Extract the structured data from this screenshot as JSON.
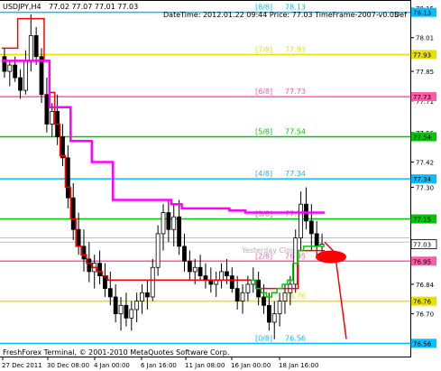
{
  "header": {
    "title": "USDJPY,H4",
    "ohlc": "77.02 77.07 77.01 77.03",
    "info": "DateTime: 2012.01.22 09:44   Price: 77.03   TimeFrame-2007-v0.05",
    "corner_text": "Def"
  },
  "footer": {
    "copyright": "FreshForex Terminal, © 2001-2010 MetaQuotes Software Corp."
  },
  "chart_data": {
    "type": "candlestick",
    "ylim": [
      76.54,
      78.18
    ],
    "y_ticks": [
      "78.15",
      "78.01",
      "77.85",
      "77.71",
      "77.56",
      "77.42",
      "77.30",
      "77.15",
      "77.03",
      "76.84",
      "76.70",
      "76.56"
    ],
    "x_ticks": [
      "27 Dec 2011",
      "30 Dec 08:00",
      "4 Jan 00:00",
      "6 Jan 16:00",
      "11 Jan 08:00",
      "16 Jan 00:00",
      "18 Jan 16:00"
    ],
    "murrey_levels": [
      {
        "label": "[8/8]",
        "value": 78.13,
        "color": "#00c0ff"
      },
      {
        "label": "[7/8]",
        "value": 77.93,
        "color": "#e8e000"
      },
      {
        "label": "[6/8]",
        "value": 77.73,
        "color": "#ff5aa8"
      },
      {
        "label": "[5/8]",
        "value": 77.54,
        "color": "#00c800"
      },
      {
        "label": "[4/8]",
        "value": 77.34,
        "color": "#00c0ff"
      },
      {
        "label": "[3/8]",
        "value": 77.15,
        "color": "#00c800"
      },
      {
        "label": "[2/8]",
        "value": 76.95,
        "color": "#ff5aa8"
      },
      {
        "label": "[1/8]",
        "value": 76.76,
        "color": "#e8e000"
      },
      {
        "label": "[0/8]",
        "value": 76.56,
        "color": "#00c0ff"
      }
    ],
    "level_value_labels": [
      "78.13",
      "77.93",
      "77.73",
      "77.54",
      "77.34",
      "77.15",
      "76.95",
      "76.76",
      "76.56"
    ],
    "right_badges": [
      {
        "text": "78.13",
        "color": "#00c0ff"
      },
      {
        "text": "77.93",
        "color": "#e8e000"
      },
      {
        "text": "77.73",
        "color": "#ff5aa8"
      },
      {
        "text": "77.54",
        "color": "#00c800"
      },
      {
        "text": "77.34",
        "color": "#00c0ff"
      },
      {
        "text": "77.15",
        "color": "#00c800"
      },
      {
        "text": "76.95",
        "color": "#ff5aa8"
      },
      {
        "text": "76.76",
        "color": "#e8e000"
      },
      {
        "text": "76.56",
        "color": "#00c0ff"
      }
    ],
    "current_price": "77.03",
    "yesterday_close_label": "Yesterday Close",
    "candles": [
      [
        77.92,
        77.96,
        77.82,
        77.85
      ],
      [
        77.85,
        77.9,
        77.78,
        77.88
      ],
      [
        77.88,
        77.92,
        77.8,
        77.82
      ],
      [
        77.82,
        77.86,
        77.72,
        77.76
      ],
      [
        77.76,
        77.95,
        77.74,
        77.9
      ],
      [
        77.9,
        78.12,
        77.85,
        78.02
      ],
      [
        78.02,
        78.06,
        77.88,
        77.92
      ],
      [
        77.92,
        77.96,
        77.7,
        77.74
      ],
      [
        77.74,
        77.82,
        77.56,
        77.6
      ],
      [
        77.6,
        77.7,
        77.54,
        77.66
      ],
      [
        77.66,
        77.74,
        77.5,
        77.54
      ],
      [
        77.54,
        77.6,
        77.4,
        77.44
      ],
      [
        77.44,
        77.5,
        77.2,
        77.25
      ],
      [
        77.25,
        77.32,
        77.05,
        77.1
      ],
      [
        77.1,
        77.18,
        76.98,
        77.02
      ],
      [
        77.02,
        77.1,
        76.9,
        76.96
      ],
      [
        76.96,
        77.04,
        76.85,
        76.9
      ],
      [
        76.9,
        76.98,
        76.82,
        76.94
      ],
      [
        76.94,
        77.0,
        76.84,
        76.88
      ],
      [
        76.88,
        76.94,
        76.78,
        76.82
      ],
      [
        76.82,
        76.9,
        76.74,
        76.78
      ],
      [
        76.78,
        76.84,
        76.66,
        76.7
      ],
      [
        76.7,
        76.78,
        76.62,
        76.74
      ],
      [
        76.74,
        76.8,
        76.64,
        76.68
      ],
      [
        76.68,
        76.76,
        76.62,
        76.72
      ],
      [
        76.72,
        76.8,
        76.66,
        76.76
      ],
      [
        76.76,
        76.84,
        76.7,
        76.8
      ],
      [
        76.8,
        76.86,
        76.72,
        76.78
      ],
      [
        76.78,
        76.96,
        76.76,
        76.92
      ],
      [
        76.92,
        77.12,
        76.88,
        77.08
      ],
      [
        77.08,
        77.22,
        77.0,
        77.18
      ],
      [
        77.18,
        77.24,
        77.04,
        77.1
      ],
      [
        77.1,
        77.22,
        77.02,
        77.16
      ],
      [
        77.16,
        77.24,
        76.98,
        77.02
      ],
      [
        77.02,
        77.08,
        76.9,
        76.95
      ],
      [
        76.95,
        77.0,
        76.86,
        76.9
      ],
      [
        76.9,
        76.96,
        76.84,
        76.92
      ],
      [
        76.92,
        76.98,
        76.86,
        76.88
      ],
      [
        76.88,
        76.94,
        76.82,
        76.86
      ],
      [
        76.86,
        76.92,
        76.8,
        76.84
      ],
      [
        76.84,
        76.9,
        76.78,
        76.86
      ],
      [
        76.86,
        76.94,
        76.82,
        76.9
      ],
      [
        76.9,
        76.96,
        76.84,
        76.88
      ],
      [
        76.88,
        76.92,
        76.8,
        76.82
      ],
      [
        76.82,
        76.88,
        76.72,
        76.76
      ],
      [
        76.76,
        76.84,
        76.7,
        76.8
      ],
      [
        76.8,
        76.88,
        76.76,
        76.84
      ],
      [
        76.84,
        76.92,
        76.8,
        76.86
      ],
      [
        76.86,
        76.9,
        76.74,
        76.78
      ],
      [
        76.78,
        76.84,
        76.7,
        76.74
      ],
      [
        76.74,
        76.8,
        76.62,
        76.66
      ],
      [
        76.66,
        76.76,
        76.58,
        76.7
      ],
      [
        76.7,
        76.8,
        76.64,
        76.76
      ],
      [
        76.76,
        76.84,
        76.7,
        76.8
      ],
      [
        76.8,
        76.88,
        76.74,
        76.84
      ],
      [
        76.84,
        77.1,
        76.8,
        77.06
      ],
      [
        77.06,
        77.28,
        77.0,
        77.22
      ],
      [
        77.22,
        77.3,
        77.1,
        77.14
      ],
      [
        77.14,
        77.22,
        77.0,
        77.08
      ],
      [
        77.08,
        77.14,
        76.96,
        77.02
      ],
      [
        77.02,
        77.08,
        76.96,
        77.03
      ]
    ],
    "magenta_line": [
      77.9,
      77.9,
      77.9,
      77.9,
      77.9,
      77.9,
      77.9,
      77.9,
      77.9,
      77.68,
      77.68,
      77.68,
      77.68,
      77.52,
      77.52,
      77.52,
      77.52,
      77.42,
      77.42,
      77.42,
      77.42,
      77.24,
      77.24,
      77.24,
      77.24,
      77.24,
      77.24,
      77.24,
      77.24,
      77.24,
      77.24,
      77.24,
      77.22,
      77.22,
      77.2,
      77.2,
      77.2,
      77.2,
      77.2,
      77.2,
      77.2,
      77.2,
      77.2,
      77.19,
      77.19,
      77.19,
      77.18,
      77.18,
      77.18,
      77.18,
      77.18,
      77.18,
      77.18,
      77.18,
      77.18,
      77.18,
      77.18,
      77.18,
      77.18,
      77.18,
      77.18
    ],
    "red_line": [
      77.96,
      77.96,
      77.96,
      78.1,
      78.1,
      78.1,
      78.1,
      78.1,
      77.9,
      77.75,
      77.6,
      77.45,
      77.3,
      77.15,
      77.02,
      76.98,
      76.94,
      76.92,
      76.9,
      76.88,
      76.86,
      76.86,
      76.86,
      76.86,
      76.86,
      76.86,
      76.86,
      76.86,
      76.86,
      76.86,
      76.86,
      76.86,
      76.86,
      76.86,
      76.86,
      76.86,
      76.86,
      76.86,
      76.86,
      76.86,
      76.86,
      76.86,
      76.86,
      76.86,
      76.86,
      76.86,
      76.86,
      76.86,
      76.82,
      76.82,
      76.82,
      76.82,
      76.82,
      76.82,
      76.82,
      76.82,
      77.0,
      77.0,
      77.0,
      77.0,
      77.0
    ],
    "green_line": [
      null,
      null,
      null,
      null,
      null,
      null,
      null,
      null,
      null,
      null,
      null,
      null,
      null,
      null,
      null,
      null,
      null,
      null,
      null,
      null,
      null,
      null,
      null,
      null,
      null,
      null,
      null,
      null,
      null,
      null,
      null,
      null,
      null,
      null,
      null,
      null,
      null,
      null,
      null,
      null,
      null,
      null,
      null,
      null,
      null,
      null,
      null,
      76.86,
      76.82,
      76.8,
      76.78,
      76.8,
      76.82,
      76.84,
      76.86,
      76.94,
      77.0,
      77.02,
      77.02,
      77.02,
      77.02
    ],
    "forecast": {
      "from_value": 76.97,
      "to_value": 76.58
    }
  }
}
